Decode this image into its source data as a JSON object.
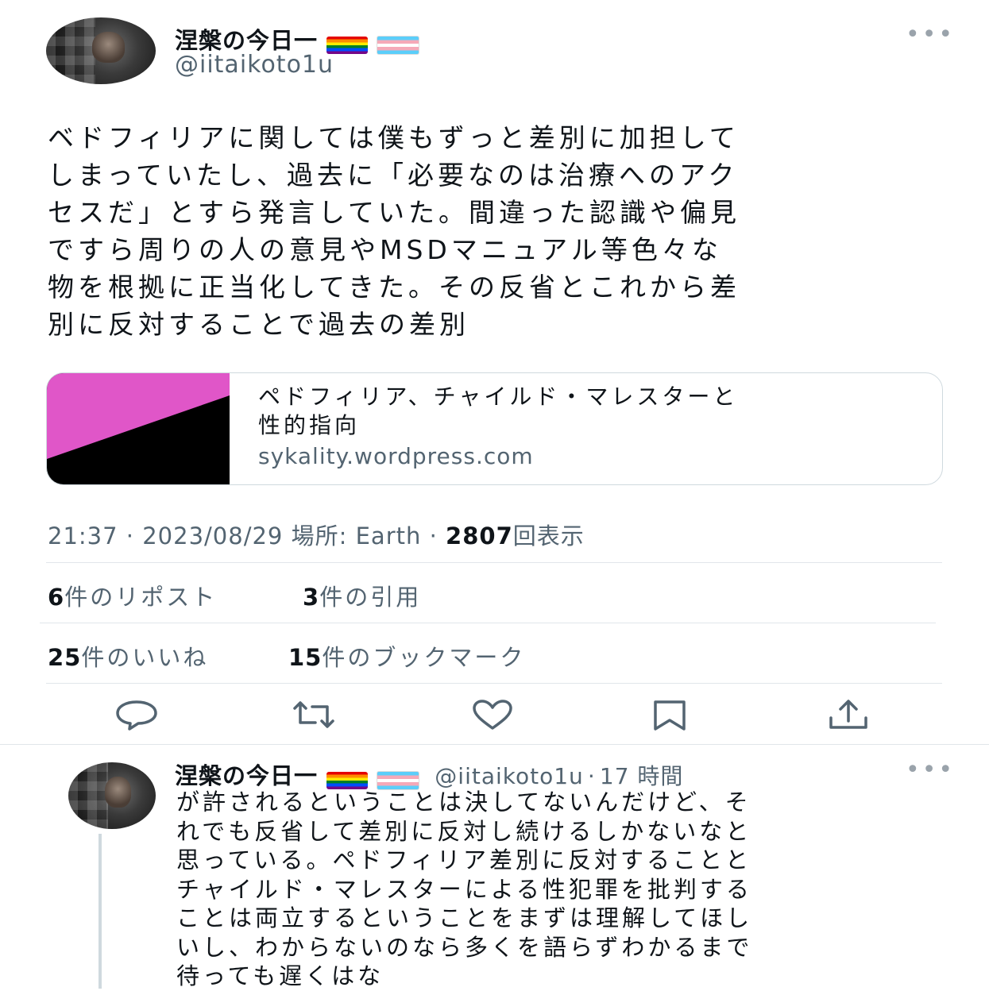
{
  "tweet": {
    "author": {
      "display_name": "涅槃の今日一",
      "flags": [
        "rainbow-flag",
        "transgender-flag"
      ],
      "handle": "@iitaikoto1u"
    },
    "text": "ベドフィリアに関しては僕もずっと差別に加担して\nしまっていたし、過去に「必要なのは治療へのアク\nセスだ」とすら発言していた。間違った認識や偏見\nですら周りの人の意見やMSDマニュアル等色々な\n物を根拠に正当化してきた。その反省とこれから差\n別に反対することで過去の差別",
    "link_card": {
      "title": "ペドフィリア、チャイルド・マレスターと\n性的指向",
      "domain": "sykality.wordpress.com",
      "image_colors": {
        "top": "#e056c8",
        "bottom": "#000000"
      }
    },
    "meta": {
      "time": "21:37",
      "date": "2023/08/29",
      "location_label": "場所: Earth",
      "separator": "·",
      "views_count": "2807",
      "views_label": "回表示"
    },
    "stats": {
      "reposts_count": "6",
      "reposts_label": "件のリポスト",
      "quotes_count": "3",
      "quotes_label": "件の引用",
      "likes_count": "25",
      "likes_label": "件のいいね",
      "bookmarks_count": "15",
      "bookmarks_label": "件のブックマーク"
    },
    "actions": [
      "reply-icon",
      "repost-icon",
      "like-icon",
      "bookmark-icon",
      "share-icon"
    ]
  },
  "reply": {
    "display_name": "涅槃の今日一",
    "handle": "@iitaikoto1u",
    "separator": "·",
    "time_ago": "17 時間",
    "text": "が許されるということは決してないんだけど、そ\nれでも反省して差別に反対し続けるしかないなと\n思っている。ペドフィリア差別に反対することと\nチャイルド・マレスターによる性犯罪を批判する\nことは両立するということをまずは理解してほし\nいし、わからないのなら多くを語らずわかるまで\n待っても遅くはな"
  },
  "colors": {
    "secondary_text": "#536471",
    "divider": "#e1e6ea",
    "more_icon": "#9aa3ab"
  }
}
